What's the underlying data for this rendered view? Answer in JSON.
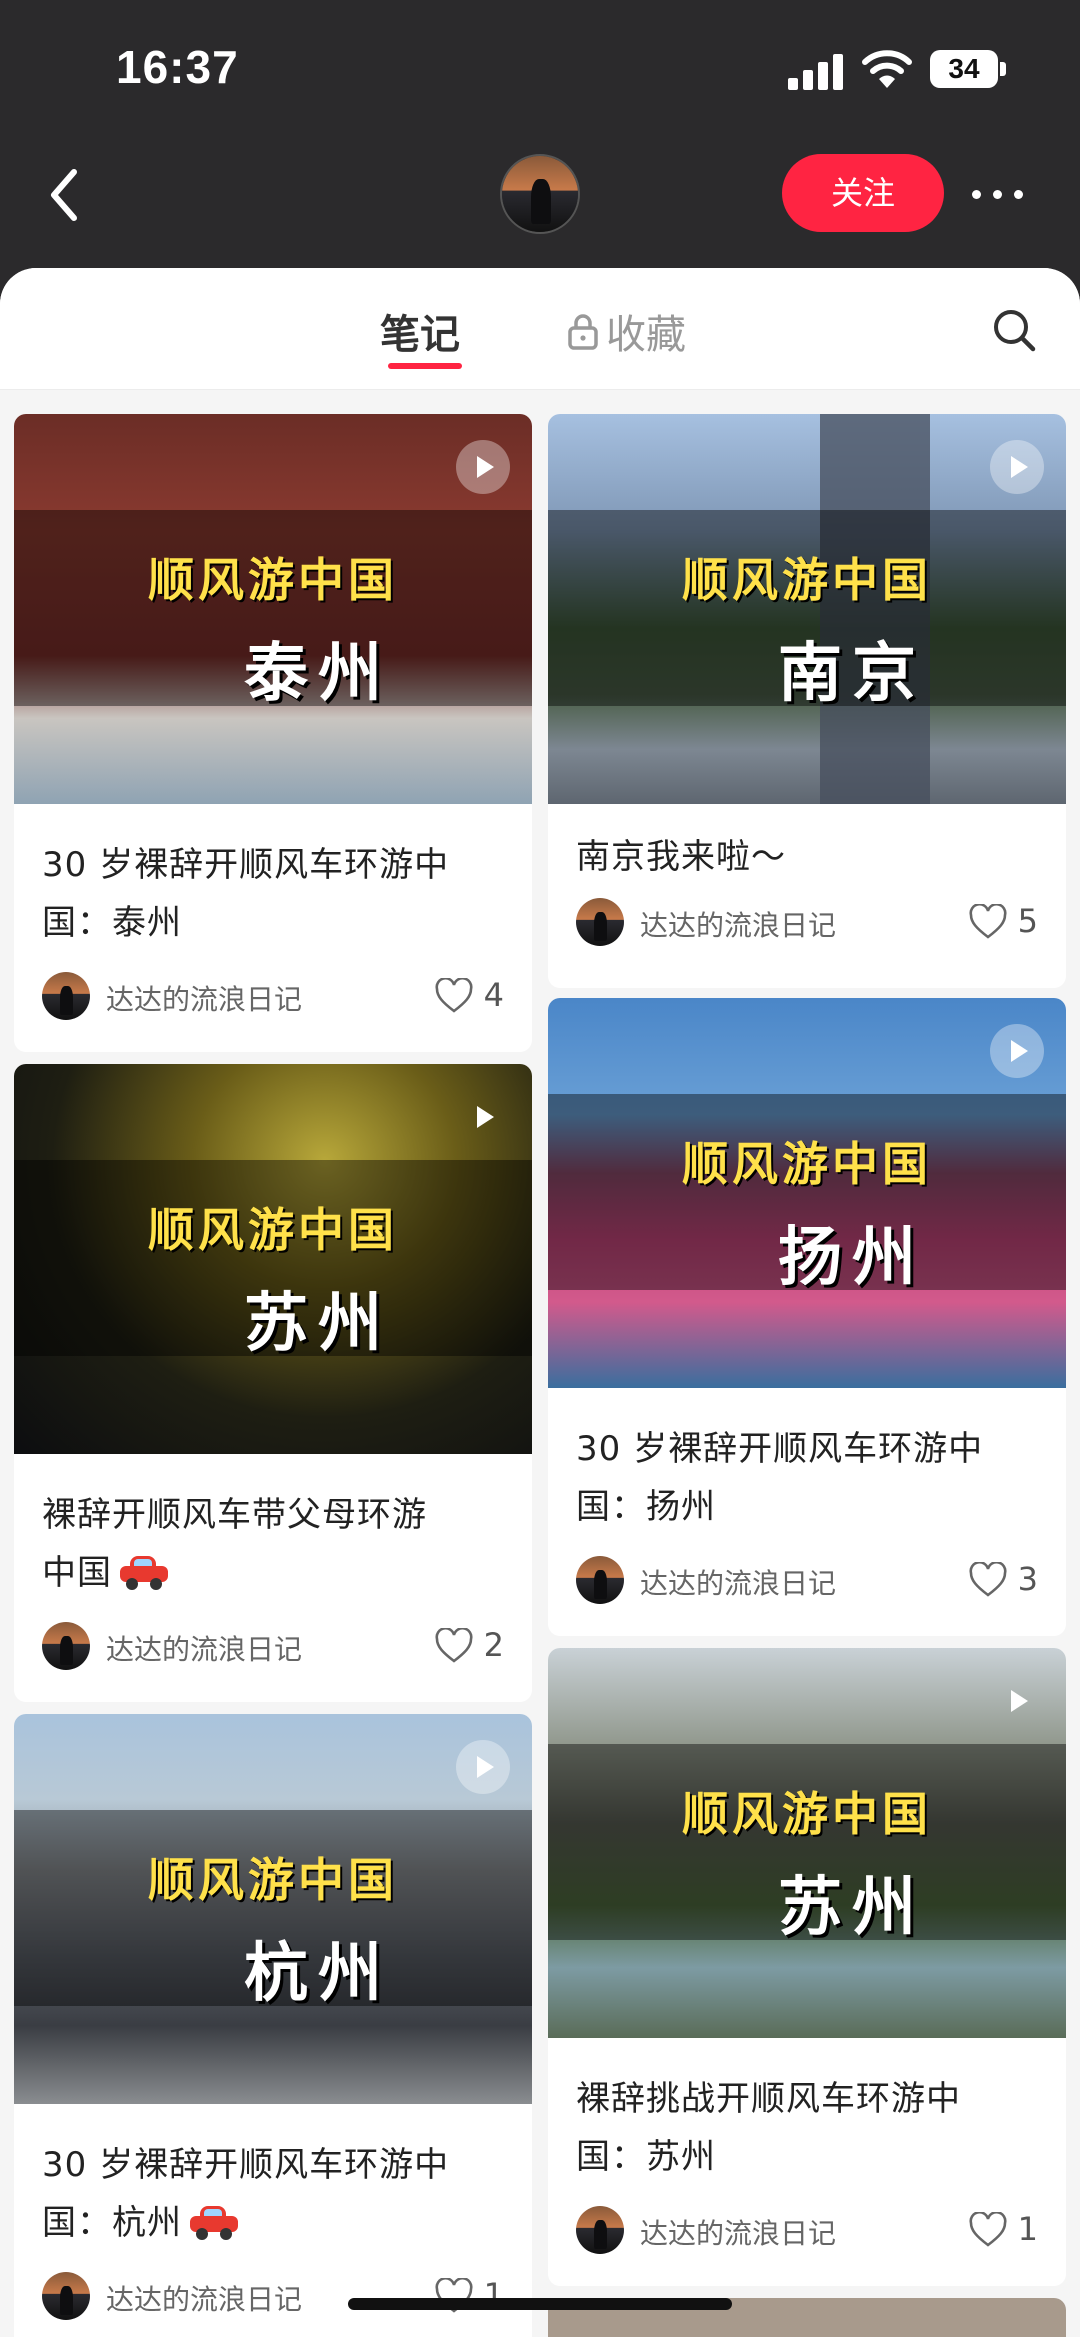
{
  "status_bar": {
    "time": "16:37",
    "battery": "34"
  },
  "header": {
    "follow_label": "关注"
  },
  "tabs": {
    "notes": "笔记",
    "favorites": "收藏"
  },
  "author": "达达的流浪日记",
  "cover_slogan": "顺风游中国",
  "left_column": [
    {
      "city": "泰州",
      "title_line1": "30 岁裸辞开顺风车环游中",
      "title_line2": "国：泰州",
      "likes": "4"
    },
    {
      "city": "苏州",
      "title_line1": "裸辞开顺风车带父母环游",
      "title_line2": "中国",
      "likes": "2",
      "title_emoji": "car-emoji"
    },
    {
      "city": "杭州",
      "title_line1": "30 岁裸辞开顺风车环游中",
      "title_line2": "国：杭州",
      "likes": "1",
      "title_emoji": "car-emoji"
    }
  ],
  "right_column": [
    {
      "city": "南京",
      "title_line1": "南京我来啦～",
      "likes": "5"
    },
    {
      "city": "扬州",
      "title_line1": "30 岁裸辞开顺风车环游中",
      "title_line2": "国：扬州",
      "likes": "3"
    },
    {
      "city": "苏州",
      "title_line1": "裸辞挑战开顺风车环游中",
      "title_line2": "国：苏州",
      "likes": "1"
    }
  ],
  "colors": {
    "accent": "#ff2442",
    "header_bg": "#2b2a2c",
    "cover_slogan": "#ffe14a"
  }
}
